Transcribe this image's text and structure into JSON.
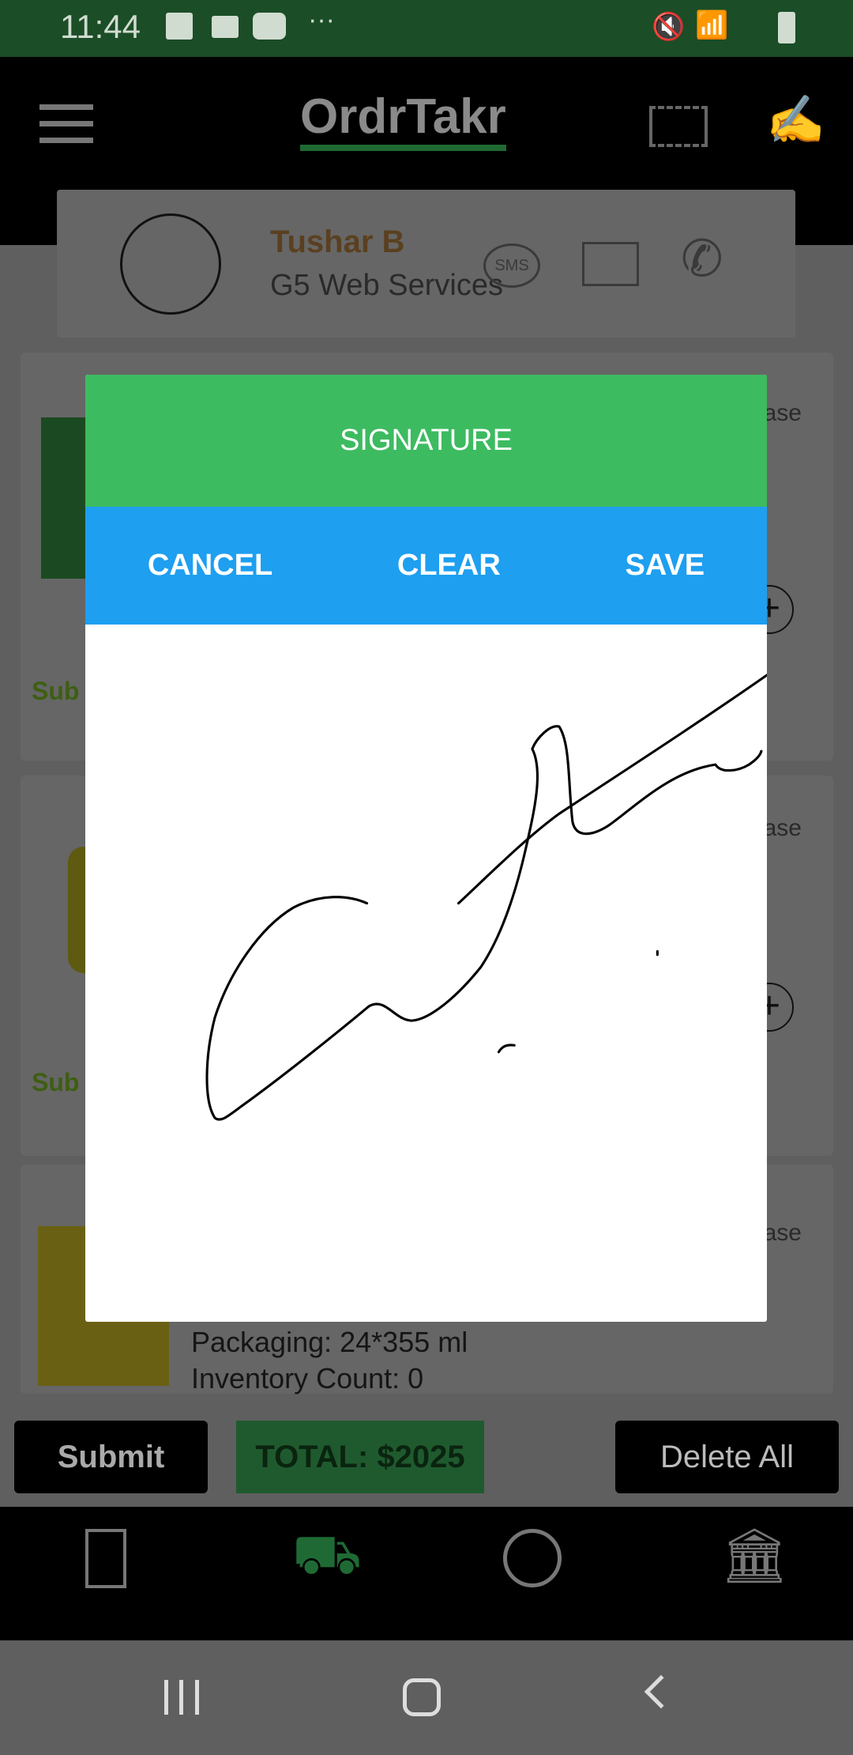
{
  "status_bar": {
    "time": "11:44",
    "more": "···"
  },
  "header": {
    "logo": "OrdrTakr"
  },
  "contact": {
    "name": "Tushar B",
    "company": "G5 Web Services",
    "sms_label": "SMS"
  },
  "products": [
    {
      "unit": "case",
      "subtotal_label": "Sub"
    },
    {
      "unit": "case",
      "subtotal_label": "Sub"
    },
    {
      "unit": "case",
      "packaging": "Packaging: 24*355 ml",
      "inventory": "Inventory Count: 0"
    }
  ],
  "actions": {
    "submit": "Submit",
    "total": "TOTAL: $2025",
    "delete_all": "Delete All"
  },
  "dialog": {
    "title": "SIGNATURE",
    "cancel": "CANCEL",
    "clear": "CLEAR",
    "save": "SAVE"
  },
  "colors": {
    "brand_green": "#3dbb60",
    "action_blue": "#1e9ff0",
    "status_green": "#2e7d3a"
  }
}
